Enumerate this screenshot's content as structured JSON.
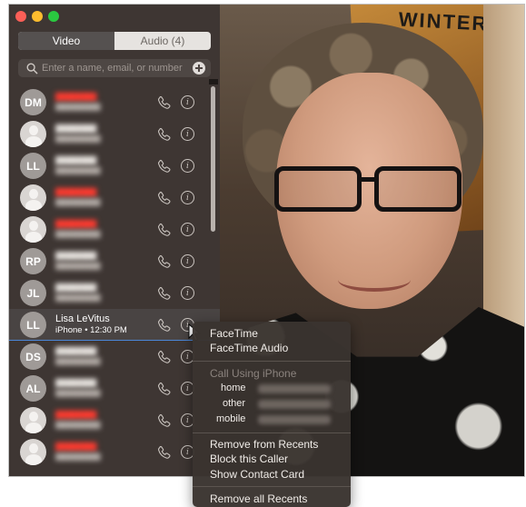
{
  "window": {
    "segmented": {
      "video": "Video",
      "audio": "Audio (4)",
      "selected": "video"
    }
  },
  "search": {
    "placeholder": "Enter a name, email, or number"
  },
  "recents": [
    {
      "avatar": "DM",
      "avatar_type": "initials",
      "name_missed": true
    },
    {
      "avatar": "",
      "avatar_type": "silhouette",
      "name_missed": false
    },
    {
      "avatar": "LL",
      "avatar_type": "initials",
      "name_missed": false
    },
    {
      "avatar": "",
      "avatar_type": "silhouette",
      "name_missed": true
    },
    {
      "avatar": "",
      "avatar_type": "silhouette",
      "name_missed": true
    },
    {
      "avatar": "RP",
      "avatar_type": "initials",
      "name_missed": false
    },
    {
      "avatar": "JL",
      "avatar_type": "initials",
      "name_missed": false
    },
    {
      "avatar": "LL",
      "avatar_type": "initials",
      "name": "Lisa LeVitus",
      "sub": "iPhone • 12:30 PM",
      "selected": true
    },
    {
      "avatar": "DS",
      "avatar_type": "initials",
      "name_missed": false
    },
    {
      "avatar": "AL",
      "avatar_type": "initials",
      "name_missed": false
    },
    {
      "avatar": "",
      "avatar_type": "silhouette",
      "name_missed": true
    },
    {
      "avatar": "",
      "avatar_type": "silhouette",
      "name_missed": true
    }
  ],
  "context_menu": {
    "facetime": "FaceTime",
    "facetime_audio": "FaceTime Audio",
    "call_using_iphone": "Call Using iPhone",
    "home": "home",
    "other": "other",
    "mobile": "mobile",
    "remove_from_recents": "Remove from Recents",
    "block_caller": "Block this Caller",
    "show_contact_card": "Show Contact Card",
    "remove_all_recents": "Remove all Recents"
  },
  "colors": {
    "missed": "#ff3b30",
    "selection_line": "#4b86d6",
    "close": "#fc5f57",
    "minimize": "#fdbc2e",
    "zoom": "#2ac940"
  }
}
